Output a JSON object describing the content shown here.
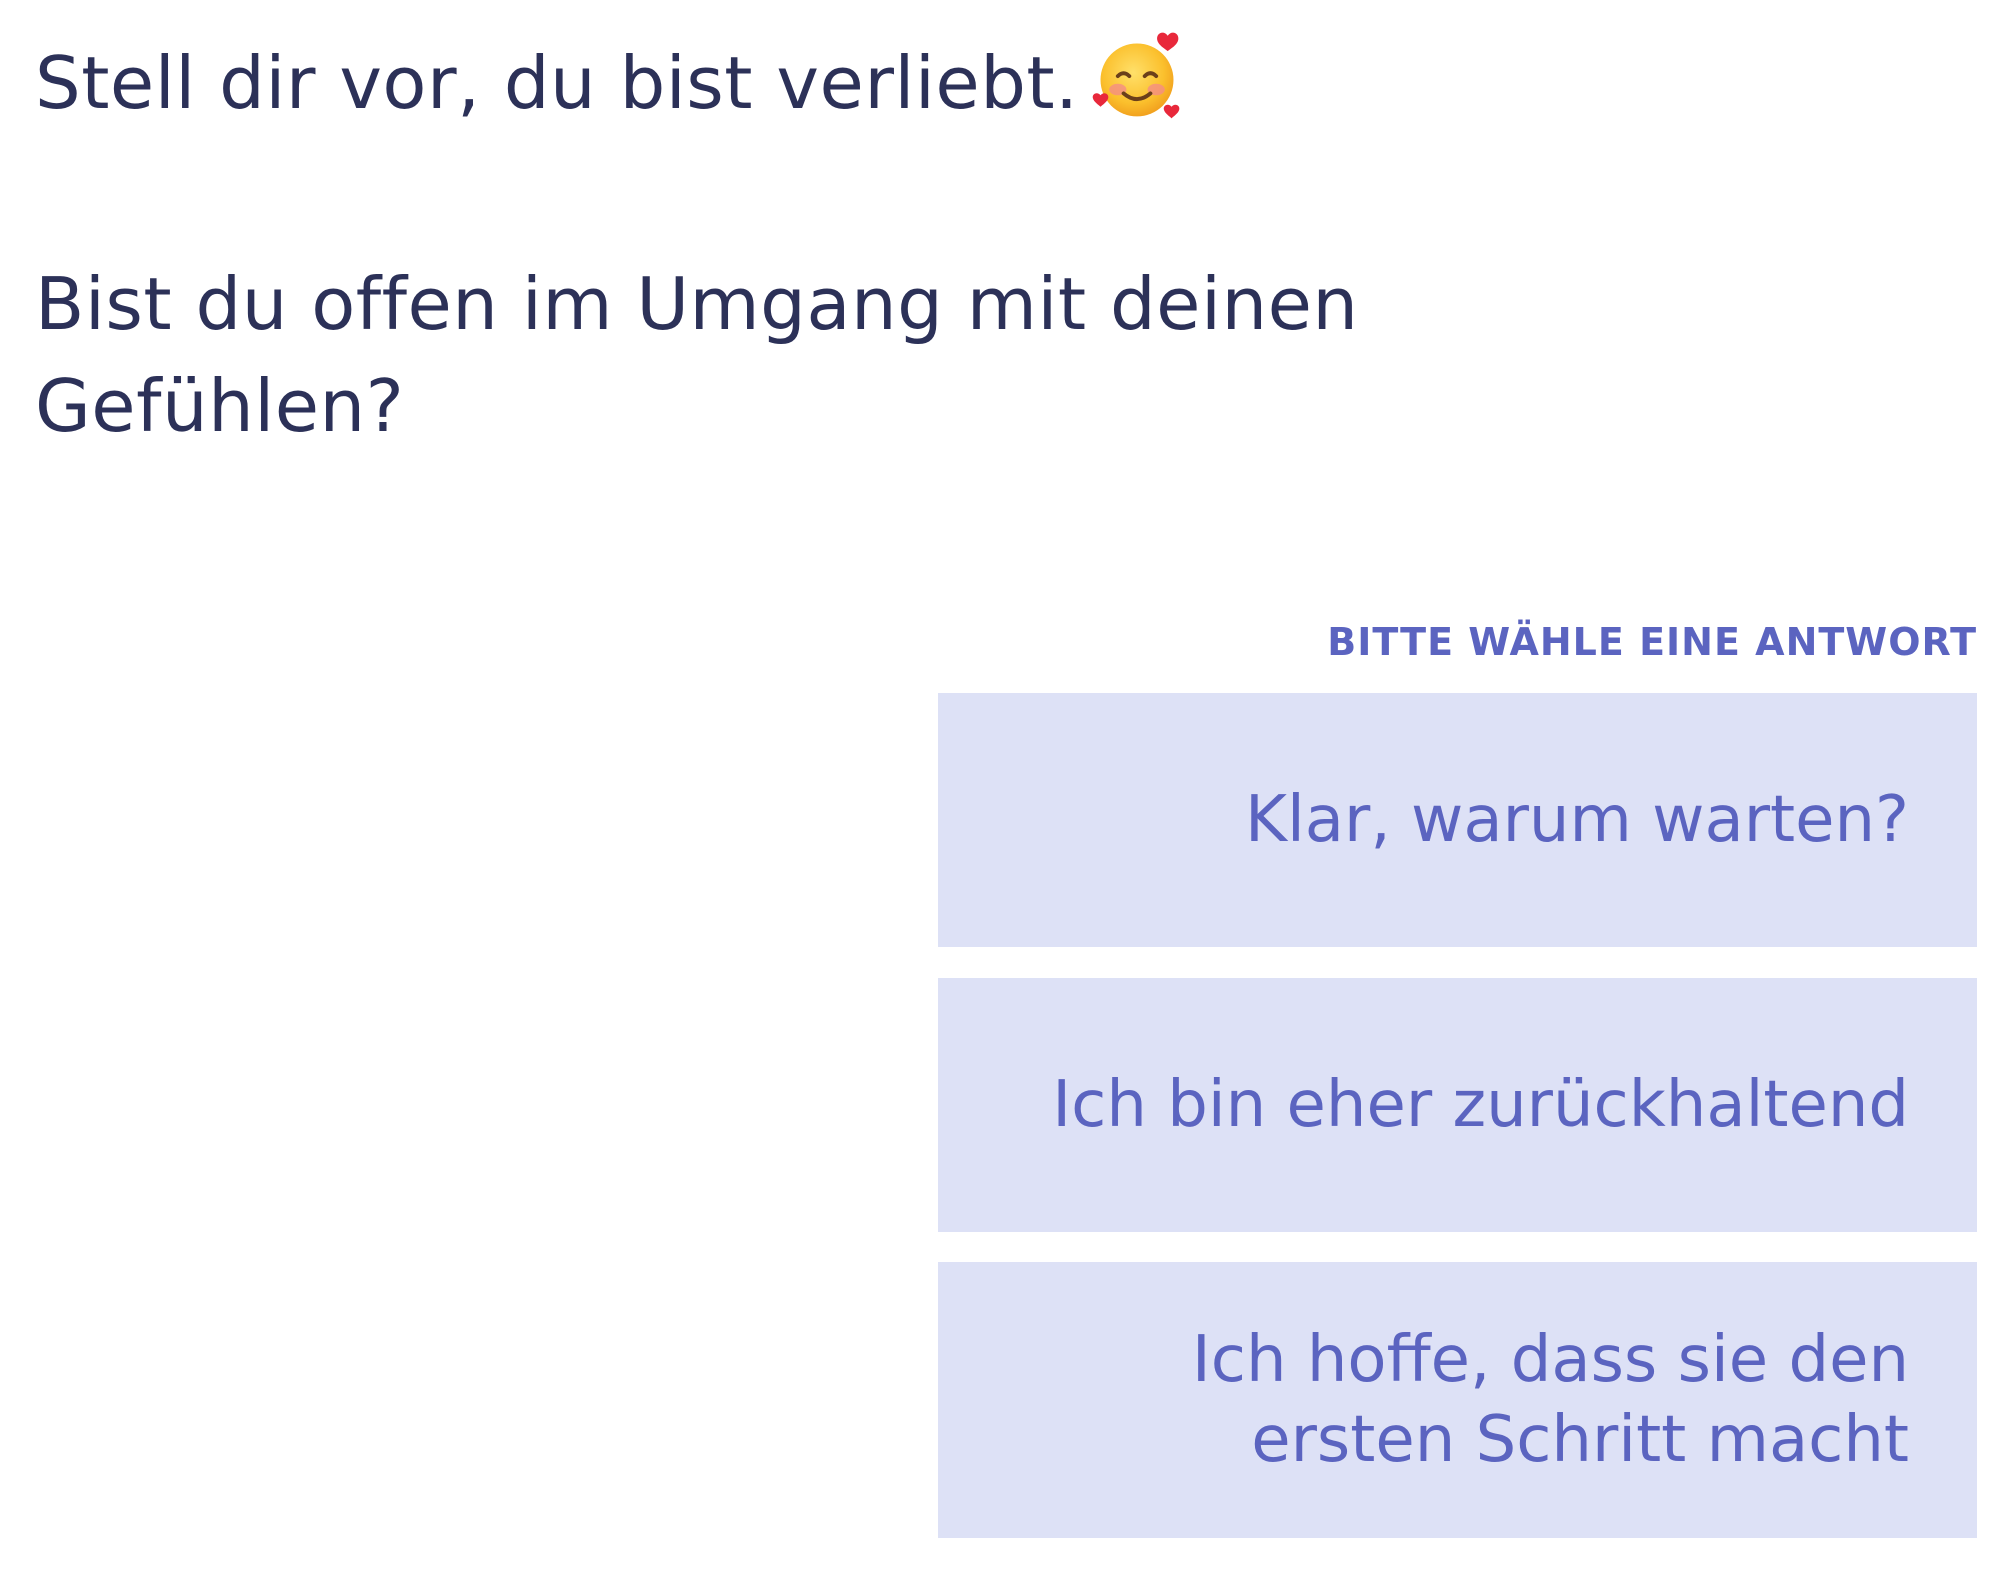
{
  "chat": {
    "intro": "Stell dir vor, du bist verliebt.",
    "intro_emoji": "smiling-face-with-hearts-icon",
    "question": "Bist du offen im Umgang mit deinen Gefühlen?"
  },
  "answers": {
    "prompt": "BITTE WÄHLE EINE ANTWORT",
    "options": [
      {
        "label": "Klar, warum warten?"
      },
      {
        "label": "Ich bin eher zurückhaltend"
      },
      {
        "label": "Ich hoffe, dass sie den ersten Schritt macht"
      }
    ]
  },
  "colors": {
    "text_primary": "#2c3158",
    "accent": "#5b64c0",
    "option_background": "#dde1f6"
  }
}
